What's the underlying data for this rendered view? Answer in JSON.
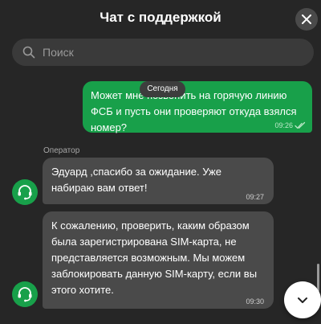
{
  "header": {
    "title": "Чат с поддержкой",
    "close_icon": "close-icon"
  },
  "search": {
    "placeholder": "Поиск",
    "value": "",
    "icon": "search-icon"
  },
  "date_badge": "Сегодня",
  "messages": [
    {
      "direction": "outgoing",
      "text": "Может мне позвонить на горячую линию ФСБ и пусть они проверяют откуда взялся номер?",
      "time": "09:26",
      "status_icon": "double-check-icon"
    },
    {
      "direction": "incoming",
      "sender": "Оператор",
      "text": "Эдуард ,спасибо за ожидание. Уже набираю вам ответ!",
      "time": "09:27",
      "avatar_icon": "support-agent-icon"
    },
    {
      "direction": "incoming",
      "text": "К сожалению, проверить, каким образом была зарегистрирована SIM-карта, не представляется возможным. Мы можем заблокировать данную SIM-карту, если вы этого хотите.",
      "time": "09:30",
      "avatar_icon": "support-agent-icon"
    }
  ],
  "scroll_down_icon": "chevron-down-icon",
  "colors": {
    "background": "#262626",
    "outgoing_bubble": "#18a04a",
    "incoming_bubble": "#4a4a4a",
    "accent": "#18a04a"
  }
}
